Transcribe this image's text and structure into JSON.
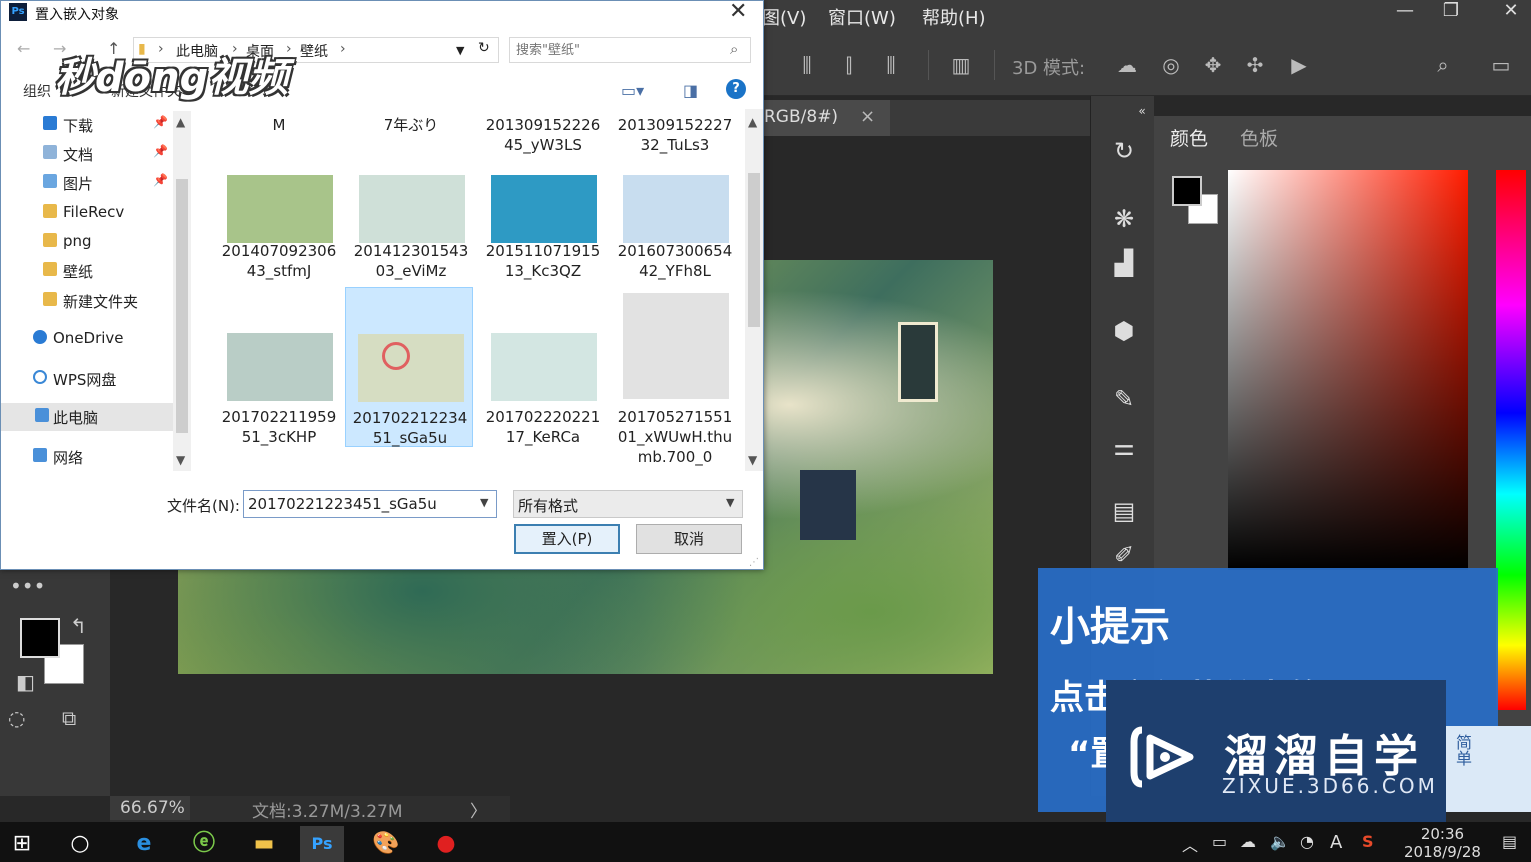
{
  "photoshop": {
    "menus": [
      "图(V)",
      "窗口(W)",
      "帮助(H)"
    ],
    "options_bar": {
      "mode_label": "3D 模式:"
    },
    "doc_tab": {
      "label": "RGB/8#)",
      "close": "×"
    },
    "status": {
      "zoom": "66.67%",
      "doc": "文档:3.27M/3.27M",
      "arrow": "〉"
    },
    "panel": {
      "tab_color": "颜色",
      "tab_swatches": "色板",
      "collapse": "«"
    },
    "window_controls": {
      "minimize": "—",
      "restore": "❐",
      "close": "✕"
    }
  },
  "tip": {
    "title": "小提示",
    "line1": "点击文件菜单中的",
    "line2": "“置"
  },
  "watermark_logo": {
    "title": "溜溜自学",
    "url": "ZIXUE.3D66.COM"
  },
  "sticker": {
    "text": "简单"
  },
  "dialog": {
    "title": "置入嵌入对象",
    "close": "✕",
    "brand_watermark": "秒dōng视频",
    "address": [
      "此电脑",
      "桌面",
      "壁纸"
    ],
    "search_placeholder": "搜索\"壁纸\"",
    "organize": "组织",
    "new_folder": "新建文件夹",
    "nav": [
      {
        "label": "下载",
        "color": "#2a7bd4",
        "pinned": true
      },
      {
        "label": "文档",
        "color": "#8fb3d9",
        "pinned": true
      },
      {
        "label": "图片",
        "color": "#6aa6e0",
        "pinned": true
      },
      {
        "label": "FileRecv",
        "color": "#e8b84a",
        "pinned": false
      },
      {
        "label": "png",
        "color": "#e8b84a",
        "pinned": false
      },
      {
        "label": "壁纸",
        "color": "#e8b84a",
        "pinned": false
      },
      {
        "label": "新建文件夹",
        "color": "#e8b84a",
        "pinned": false
      },
      {
        "label": "OneDrive",
        "color": "#2a7bd4",
        "pinned": false
      },
      {
        "label": "WPS网盘",
        "color": "#3a88d6",
        "pinned": false
      },
      {
        "label": "此电脑",
        "color": "#4a90d9",
        "pinned": false
      },
      {
        "label": "网络",
        "color": "#4a90d9",
        "pinned": false
      }
    ],
    "files_top": [
      {
        "line1": "M",
        "line2": ""
      },
      {
        "line1": "7年ぶり",
        "line2": ""
      },
      {
        "line1": "201309152226",
        "line2": "45_yW3LS"
      },
      {
        "line1": "201309152227",
        "line2": "32_TuLs3"
      }
    ],
    "files_row2": [
      {
        "line1": "201407092306",
        "line2": "43_stfmJ",
        "color": "#a8c48a"
      },
      {
        "line1": "201412301543",
        "line2": "03_eViMz",
        "color": "#cfe0d8"
      },
      {
        "line1": "201511071915",
        "line2": "13_Kc3QZ",
        "color": "#2e9ac4"
      },
      {
        "line1": "201607300654",
        "line2": "42_YFh8L",
        "color": "#c8ddef"
      }
    ],
    "files_row3": [
      {
        "line1": "201702211959",
        "line2": "51_3cKHP",
        "line3": "",
        "color": "#b9cdc6"
      },
      {
        "line1": "201702212234",
        "line2": "51_sGa5u",
        "line3": "",
        "color": "#d6ddc2"
      },
      {
        "line1": "201702220221",
        "line2": "17_KeRCa",
        "line3": "",
        "color": "#d3e6e2"
      },
      {
        "line1": "201705271551",
        "line2": "01_xWUwH.thu",
        "line3": "mb.700_0",
        "color": "#e2e2e2"
      }
    ],
    "filename_label": "文件名(N):",
    "filename_value": "20170221223451_sGa5u",
    "filetype_value": "所有格式",
    "place_button": "置入(P)",
    "cancel_button": "取消"
  },
  "taskbar": {
    "clock_time": "20:36",
    "clock_date": "2018/9/28",
    "ime": "A"
  }
}
